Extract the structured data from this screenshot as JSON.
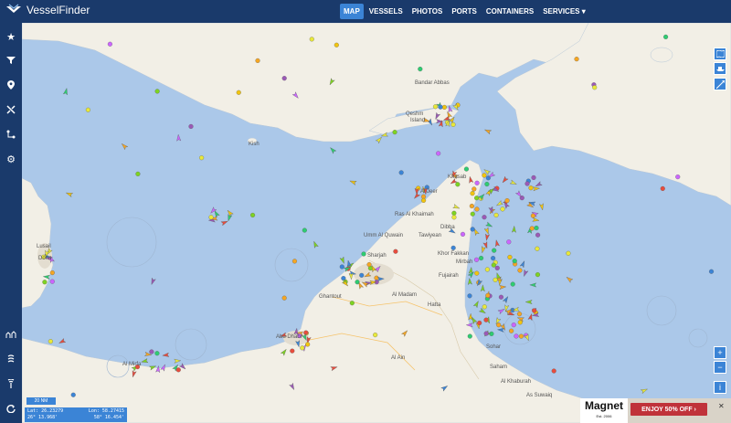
{
  "app": {
    "logo_text": "VesselFinder"
  },
  "nav": {
    "items": [
      "MAP",
      "VESSELS",
      "PHOTOS",
      "PORTS",
      "CONTAINERS",
      "SERVICES ▾"
    ],
    "active": "MAP"
  },
  "sidebar": {
    "icons": [
      "star-icon",
      "filter-icon",
      "pin-icon",
      "tools-icon",
      "route-icon",
      "gear-icon",
      "weather-icon",
      "layers-icon",
      "antenna-icon",
      "refresh-icon"
    ]
  },
  "map": {
    "places": [
      {
        "name": "Bandar Abbas",
        "id": "p1"
      },
      {
        "name": "Qeshm",
        "id": "p2"
      },
      {
        "name": "Island",
        "id": "p3"
      },
      {
        "name": "Kish",
        "id": "p4"
      },
      {
        "name": "Khasab",
        "id": "p5"
      },
      {
        "name": "Al Jeer",
        "id": "p6"
      },
      {
        "name": "Ras Al Khaimah",
        "id": "p7"
      },
      {
        "name": "Dibba",
        "id": "p8"
      },
      {
        "name": "Tawiyean",
        "id": "p9"
      },
      {
        "name": "Umm Al Quwain",
        "id": "p10"
      },
      {
        "name": "Khor Fakkan",
        "id": "p11"
      },
      {
        "name": "Mirbah",
        "id": "p12"
      },
      {
        "name": "Sharjah",
        "id": "p13"
      },
      {
        "name": "Fujairah",
        "id": "p14"
      },
      {
        "name": "Ghantout",
        "id": "p15"
      },
      {
        "name": "Al Madam",
        "id": "p16"
      },
      {
        "name": "Hatta",
        "id": "p17"
      },
      {
        "name": "Abu Dhabi",
        "id": "p18"
      },
      {
        "name": "Al Ain",
        "id": "p19"
      },
      {
        "name": "Sohar",
        "id": "p20"
      },
      {
        "name": "Saham",
        "id": "p21"
      },
      {
        "name": "Al Khaburah",
        "id": "p22"
      },
      {
        "name": "As Suwaiq",
        "id": "p23"
      },
      {
        "name": "Lusail",
        "id": "p24"
      },
      {
        "name": "Doha",
        "id": "p25"
      },
      {
        "name": "Al Mirfa",
        "id": "p26"
      }
    ]
  },
  "controls": {
    "zoom_in": "+",
    "zoom_out": "−",
    "info": "i"
  },
  "status": {
    "scale": "20 NM",
    "lat_label": "Lat:",
    "lat_value": "26.23279",
    "lon_label": "Lon:",
    "lon_value": "58.27415",
    "lat_dms": "26° 13.968'",
    "lon_dms": "58° 16.454'"
  },
  "ad": {
    "brand": "Magnet",
    "brand_sub": "Est. 2006",
    "cta": "ENJOY 50% OFF ›",
    "close": "✕"
  },
  "colors": {
    "bar": "#1a3a6b",
    "accent": "#3b84d6",
    "sea": "#abc8e9",
    "land": "#f2efe6"
  }
}
